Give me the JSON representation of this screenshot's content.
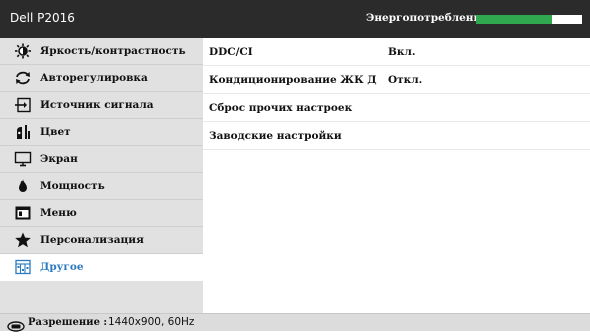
{
  "header": {
    "title": "Dell P2016",
    "energy_label": "Энергопотребление",
    "energy_level": 0.72,
    "energy_color": "#2fa84f"
  },
  "sidebar": {
    "items": [
      {
        "label": "Яркость/контрастность",
        "icon": "brightness-icon"
      },
      {
        "label": "Авторегулировка",
        "icon": "auto-adjust-icon"
      },
      {
        "label": "Источник сигнала",
        "icon": "input-source-icon"
      },
      {
        "label": "Цвет",
        "icon": "color-icon"
      },
      {
        "label": "Экран",
        "icon": "display-icon"
      },
      {
        "label": "Мощность",
        "icon": "power-icon"
      },
      {
        "label": "Меню",
        "icon": "menu-icon"
      },
      {
        "label": "Персонализация",
        "icon": "star-icon"
      },
      {
        "label": "Другое",
        "icon": "other-icon",
        "active": true
      }
    ]
  },
  "settings": {
    "rows": [
      {
        "label": "DDC/CI",
        "value": "Вкл."
      },
      {
        "label": "Кондиционирование ЖК Д",
        "value": "Откл."
      },
      {
        "label": "Сброс прочих настроек",
        "value": ""
      },
      {
        "label": "Заводские настройки",
        "value": ""
      }
    ]
  },
  "status": {
    "label": "Разрешение :",
    "value": "1440x900, 60Hz",
    "icon": "hdmi-icon"
  },
  "colors": {
    "title_bg": "#2b2b2b",
    "sidebar_bg": "#e1e1e1",
    "active_text": "#2a7abf"
  }
}
